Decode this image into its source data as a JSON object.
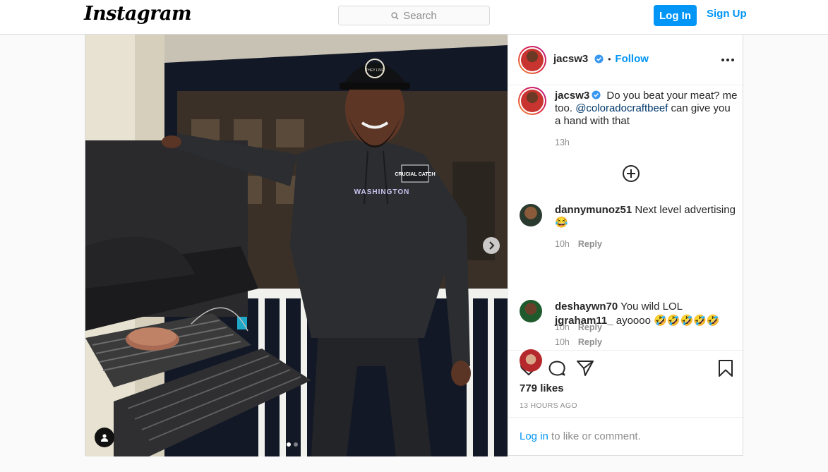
{
  "header": {
    "logo_text": "Instagram",
    "search_placeholder": "Search",
    "login_label": "Log In",
    "signup_label": "Sign Up"
  },
  "post": {
    "author": "jacsw3",
    "follow_label": "Follow",
    "separator": "•",
    "caption_text": "Do you beat your meat? me too.",
    "caption_mention": "@coloradocraftbeef",
    "caption_tail": "can give you a hand with that",
    "caption_time": "13h",
    "likes": "779 likes",
    "posted_ago": "13 HOURS AGO",
    "login_link": "Log in",
    "login_suffix": "to like or comment.",
    "hoodie_text": "WASHINGTON",
    "hoodie_patch": "CRUCIAL CATCH",
    "hat_text": "THEY LIVE"
  },
  "comments": [
    {
      "user": "dannymunoz51",
      "text": "Next level advertising 😂",
      "time": "10h",
      "reply": "Reply"
    },
    {
      "user": "deshaywn70",
      "text": "You wild LOL",
      "time": "10h",
      "reply": "Reply"
    },
    {
      "user": "jgraham11_",
      "text": "ayoooo 🤣🤣🤣🤣🤣",
      "time": "10h",
      "reply": "Reply"
    }
  ],
  "colors": {
    "brand_blue": "#0095f6",
    "mention_blue": "#00376b",
    "muted": "#8e8e8e",
    "border": "#dbdbdb"
  },
  "icons": [
    "search-icon",
    "chevron-right-icon",
    "user-tag-icon",
    "more-icon",
    "verified-badge-icon",
    "add-circle-icon",
    "heart-icon",
    "comment-icon",
    "share-icon",
    "bookmark-icon"
  ]
}
